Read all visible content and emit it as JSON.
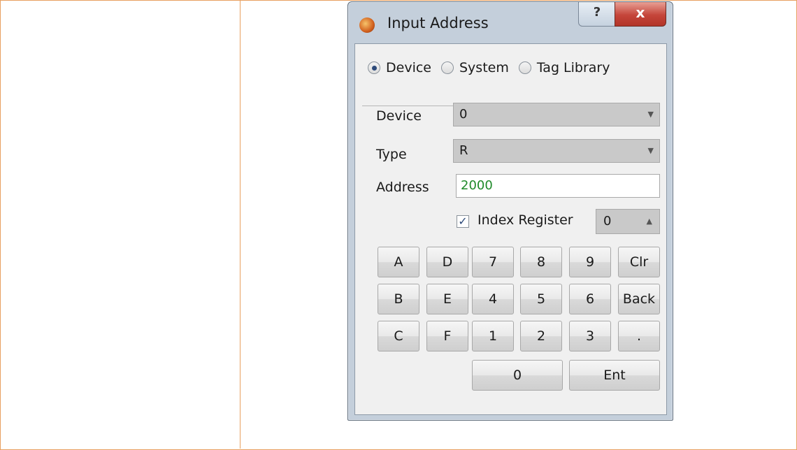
{
  "window": {
    "title": "Input Address",
    "help_label": "?",
    "close_label": "x"
  },
  "modes": [
    {
      "label": "Device",
      "selected": true
    },
    {
      "label": "System",
      "selected": false
    },
    {
      "label": "Tag Library",
      "selected": false
    }
  ],
  "fields": {
    "device_label": "Device",
    "device_value": "0",
    "type_label": "Type",
    "type_value": "R",
    "address_label": "Address",
    "address_value": "2000"
  },
  "index_register": {
    "label": "Index Register",
    "checked": true,
    "value": "0"
  },
  "keypad": {
    "row1": [
      "A",
      "D",
      "7",
      "8",
      "9",
      "Clr"
    ],
    "row2": [
      "B",
      "E",
      "4",
      "5",
      "6",
      "Back"
    ],
    "row3": [
      "C",
      "F",
      "1",
      "2",
      "3",
      "."
    ],
    "row4": [
      "0",
      "Ent"
    ]
  },
  "colors": {
    "table_border": "#e8a060",
    "address_text": "#1f8a2a",
    "close_button": "#c5453a"
  }
}
